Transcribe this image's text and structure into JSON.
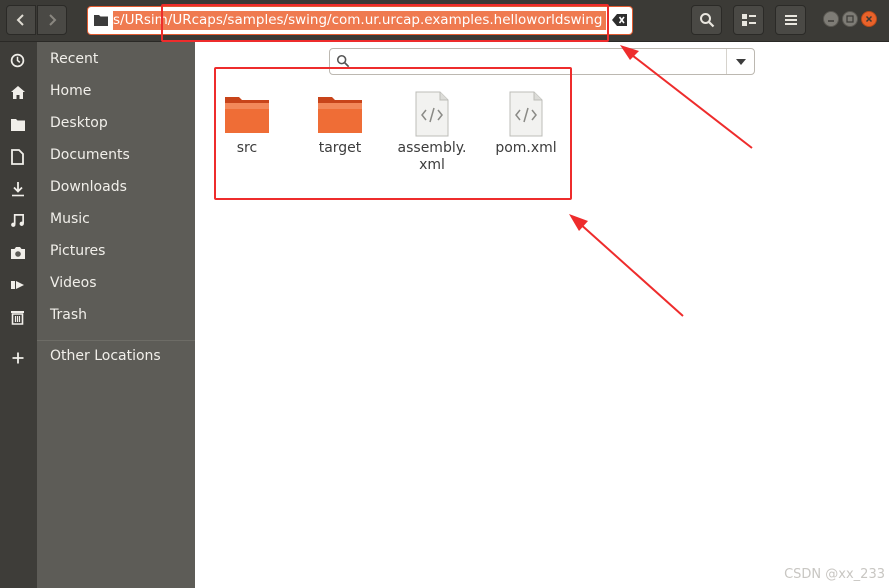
{
  "header": {
    "path": "s/URsim/URcaps/samples/swing/com.ur.urcap.examples.helloworldswing"
  },
  "sidebar": {
    "items": [
      {
        "label": "Recent",
        "icon": "clock-icon"
      },
      {
        "label": "Home",
        "icon": "home-icon"
      },
      {
        "label": "Desktop",
        "icon": "folder-icon"
      },
      {
        "label": "Documents",
        "icon": "document-icon"
      },
      {
        "label": "Downloads",
        "icon": "download-icon"
      },
      {
        "label": "Music",
        "icon": "music-icon"
      },
      {
        "label": "Pictures",
        "icon": "camera-icon"
      },
      {
        "label": "Videos",
        "icon": "video-icon"
      },
      {
        "label": "Trash",
        "icon": "trash-icon"
      },
      {
        "label": "Other Locations",
        "icon": "plus-icon"
      }
    ]
  },
  "search": {
    "placeholder": ""
  },
  "files": [
    {
      "name": "src",
      "type": "folder"
    },
    {
      "name": "target",
      "type": "folder"
    },
    {
      "name": "assembly.\nxml",
      "type": "xml"
    },
    {
      "name": "pom.xml",
      "type": "xml"
    }
  ],
  "colors": {
    "accent": "#e95420",
    "annotation": "#ee2c2c",
    "sidebar_bg": "#5d5c57",
    "header_bg": "#3b3a36"
  },
  "watermark": "CSDN @xx_233"
}
